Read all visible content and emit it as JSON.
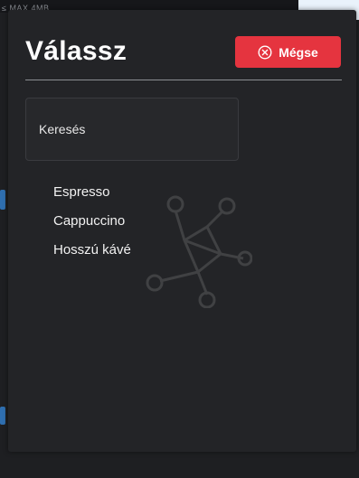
{
  "background": {
    "top_text": "≤ MAX 4MB"
  },
  "modal": {
    "title": "Válassz",
    "cancel_label": "Mégse",
    "search_placeholder": "Keresés",
    "options": [
      "Espresso",
      "Cappuccino",
      "Hosszú kávé"
    ]
  },
  "colors": {
    "modal_bg": "#232427",
    "cancel_bg": "#e5343f",
    "text": "#ffffff",
    "divider": "#8c8e93"
  },
  "icons": {
    "cancel": "close-circle-icon",
    "watermark": "molecule-icon"
  }
}
